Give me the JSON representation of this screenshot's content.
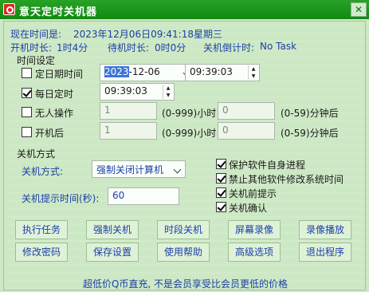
{
  "window": {
    "title": "意天定时关机器",
    "close_glyph": "✕"
  },
  "status": {
    "now_label": "现在时间是:",
    "now_value": "2023年12月06日09:41:18星期三",
    "on_label": "开机时长:",
    "on_value": "1时4分",
    "idle_label": "待机时长:",
    "idle_value": "0时0分",
    "countdown_label": "关机倒计时:",
    "countdown_value": "No Task"
  },
  "timer": {
    "group_label": "时间设定",
    "fixed_date": {
      "label": "定日期时间",
      "checked": false,
      "date_selected": "2023",
      "date_rest": "-12-06",
      "time": "09:39:03"
    },
    "daily": {
      "label": "每日定时",
      "checked": true,
      "time": "09:39:03"
    },
    "idle": {
      "label": "无人操作",
      "checked": false,
      "hours": "1",
      "hours_unit": "(0-999)小时",
      "minutes": "0",
      "minutes_unit": "(0-59)分钟后"
    },
    "boot": {
      "label": "开机后",
      "checked": false,
      "hours": "1",
      "hours_unit": "(0-999)小时",
      "minutes": "0",
      "minutes_unit": "(0-59)分钟后"
    }
  },
  "shutdown": {
    "group_label": "关机方式",
    "mode_label": "关机方式:",
    "mode_value": "强制关闭计算机",
    "prompt_label": "关机提示时间(秒):",
    "prompt_value": "60"
  },
  "options": [
    {
      "label": "保护软件自身进程",
      "checked": true
    },
    {
      "label": "禁止其他软件修改系统时间",
      "checked": true
    },
    {
      "label": "关机前提示",
      "checked": true
    },
    {
      "label": "关机确认",
      "checked": true
    }
  ],
  "buttons_row1": [
    "执行任务",
    "强制关机",
    "时段关机",
    "屏幕录像",
    "录像播放"
  ],
  "buttons_row2": [
    "修改密码",
    "保存设置",
    "使用帮助",
    "高级选项",
    "退出程序"
  ],
  "footer": "超低价Q币直充, 不是会员享受比会员更低的价格"
}
